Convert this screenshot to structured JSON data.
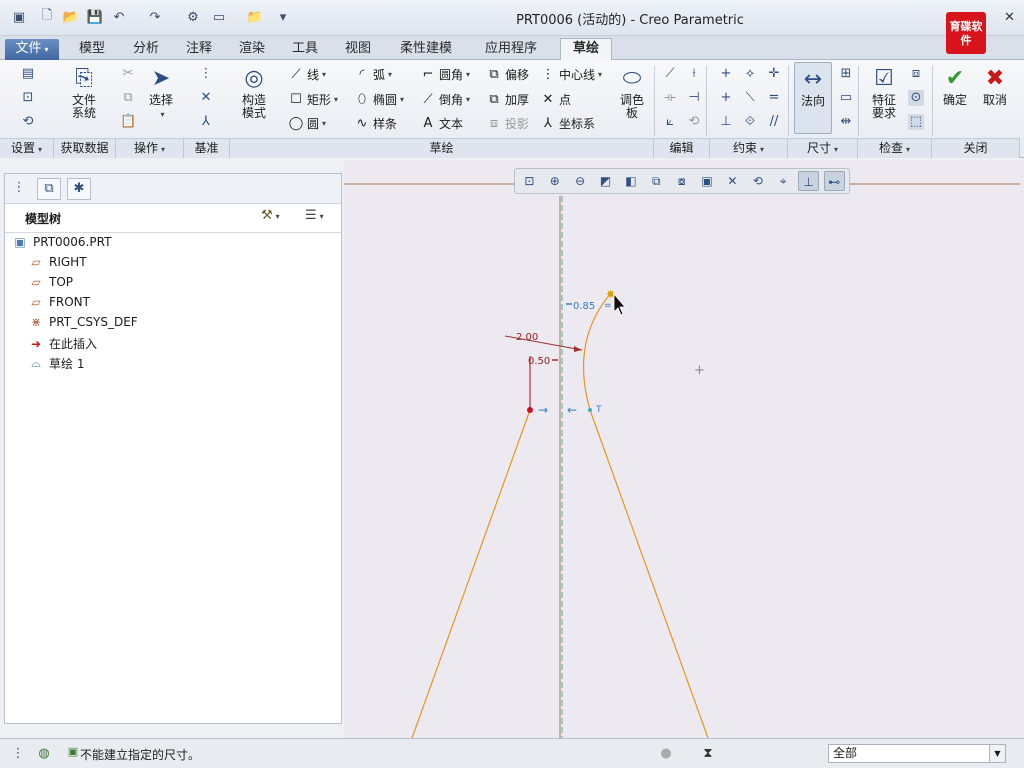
{
  "window": {
    "title": "PRT0006 (活动的) - Creo Parametric",
    "logo_text": "育碟软件"
  },
  "quick_access": {
    "icons": [
      "new-icon",
      "open-icon",
      "save-icon",
      "undo-icon",
      "redo-icon",
      "regenerate-icon",
      "windows-icon",
      "close-window-icon",
      "customize-icon"
    ]
  },
  "tabs": [
    "文件",
    "模型",
    "分析",
    "注释",
    "渲染",
    "工具",
    "视图",
    "柔性建模",
    "应用程序",
    "草绘"
  ],
  "active_tab": "草绘",
  "ribbon": {
    "setup": {
      "big": [
        {
          "label_line1": "文件",
          "label_line2": "系统"
        },
        {
          "label": "选择"
        }
      ]
    },
    "datum": {},
    "construction": {
      "line1": "构造",
      "line2": "模式"
    },
    "sketch": {
      "line": "线",
      "rectangle": "矩形",
      "circle": "圆",
      "arc": "弧",
      "ellipse": "椭圆",
      "spline": "样条",
      "fillet": "圆角",
      "chamfer": "倒角",
      "text": "文本",
      "offset": "偏移",
      "thicken": "加厚",
      "project": "投影",
      "centerline": "中心线",
      "point": "点",
      "csys": "坐标系",
      "palette_line1": "调色",
      "palette_line2": "板"
    },
    "dimension": {
      "normal": "法向"
    },
    "inspect": {
      "line1": "特征",
      "line2": "要求"
    },
    "close": {
      "ok": "确定",
      "cancel": "取消"
    },
    "groups": [
      "设置",
      "获取数据",
      "操作",
      "基准",
      "草绘",
      "编辑",
      "约束",
      "尺寸",
      "检查",
      "关闭"
    ]
  },
  "model_tree": {
    "title": "模型树",
    "items": [
      {
        "label": "PRT0006.PRT",
        "icon": "part-icon"
      },
      {
        "label": "RIGHT",
        "icon": "datum-plane-icon"
      },
      {
        "label": "TOP",
        "icon": "datum-plane-icon"
      },
      {
        "label": "FRONT",
        "icon": "datum-plane-icon"
      },
      {
        "label": "PRT_CSYS_DEF",
        "icon": "csys-icon"
      },
      {
        "label": "在此插入",
        "icon": "insert-here-icon"
      },
      {
        "label": "草绘 1",
        "icon": "sketch-icon"
      }
    ]
  },
  "sketch": {
    "dims": {
      "d1": "0.85",
      "d2": "2.00",
      "d3": "0.50"
    },
    "tangent_label": "T"
  },
  "status": {
    "message": "不能建立指定的尺寸。",
    "filter": "全部"
  }
}
